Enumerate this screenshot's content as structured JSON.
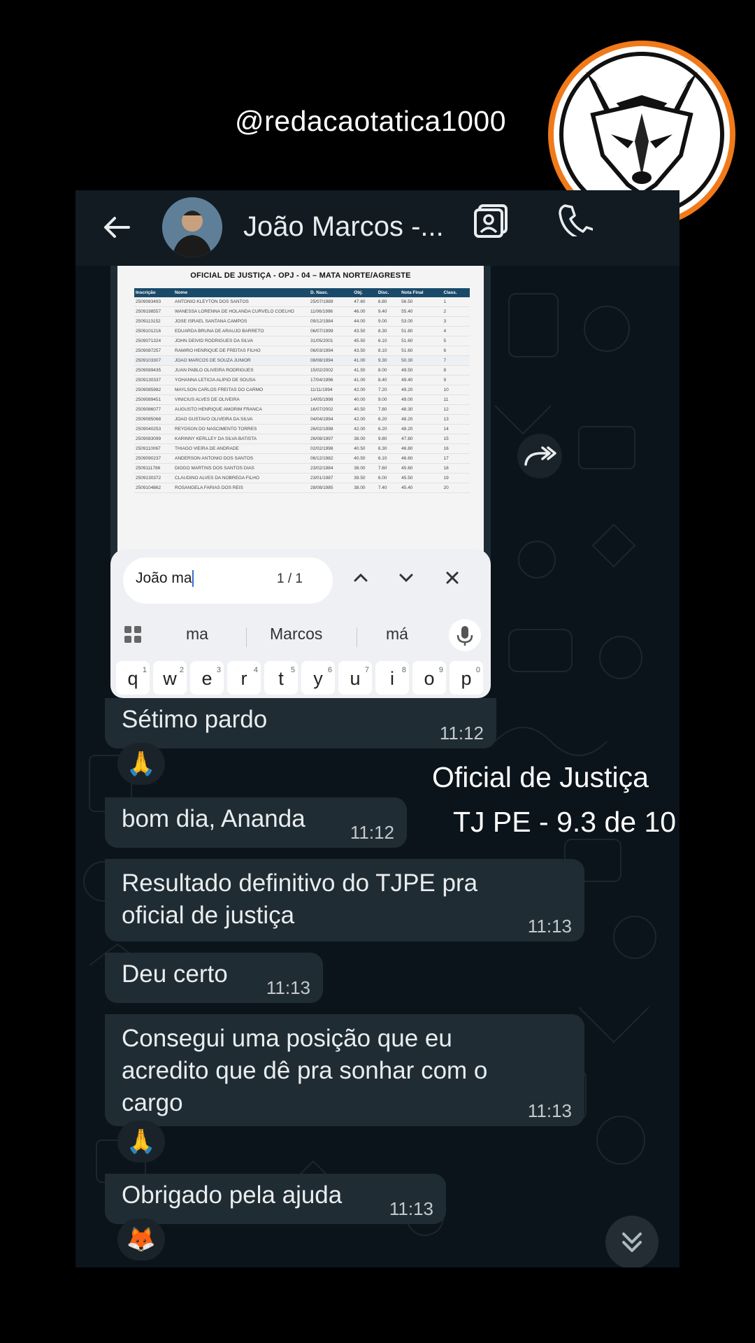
{
  "overlay": {
    "handle": "@redacaotatica1000",
    "caption_line1": "Oficial de Justiça",
    "caption_line2": "TJ PE - 9.3 de 10"
  },
  "chat_header": {
    "contact_name": "João Marcos -...",
    "icons": [
      "back-arrow-icon",
      "video-call-icon",
      "phone-call-icon"
    ]
  },
  "image_message": {
    "document_title": "OFICIAL DE JUSTIÇA - OPJ - 04 – MATA NORTE/AGRESTE",
    "columns": [
      "Inscrição",
      "Nome",
      "D. Nasc.",
      "Obj.",
      "Disc.",
      "Nota Final",
      "Class."
    ],
    "rows": [
      [
        "2509083493",
        "ANTONIO KLEYTON DOS SANTOS",
        "25/07/1989",
        "47.60",
        "8.80",
        "56.50",
        "1"
      ],
      [
        "2509198557",
        "WANESSA LORENNA DE HOLANDA CURVELO COELHO",
        "11/06/1996",
        "46.00",
        "9.40",
        "55.40",
        "2"
      ],
      [
        "2509113152",
        "JOSE ISRAEL SANTANA CAMPOS",
        "09/12/1984",
        "44.00",
        "9.00",
        "53.00",
        "3"
      ],
      [
        "2509101216",
        "EDUARDA BRUNA DE ARAUJO BARRETO",
        "06/07/1999",
        "43.50",
        "8.30",
        "51.80",
        "4"
      ],
      [
        "2509071324",
        "JOHN DEIVID RODRIGUES DA SILVA",
        "31/05/2001",
        "45.50",
        "6.10",
        "51.60",
        "5"
      ],
      [
        "2509087257",
        "RAMIRO HENRIQUE DE FREITAS FILHO",
        "06/03/1994",
        "43.50",
        "8.10",
        "51.60",
        "6"
      ],
      [
        "2509103307",
        "JOAO MARCOS DE SOUZA JUNIOR",
        "08/08/1994",
        "41.00",
        "9.30",
        "50.30",
        "7"
      ],
      [
        "2509089435",
        "JUAN PABLO OLIVEIRA RODRIGUES",
        "15/02/2002",
        "41.50",
        "8.00",
        "49.50",
        "8"
      ],
      [
        "2509130337",
        "YOHANNA LETICIA ALIPIO DE SOUSA",
        "17/04/1996",
        "41.00",
        "8.40",
        "49.40",
        "9"
      ],
      [
        "2509085982",
        "MAYLSON CARLOS FREITAS DO CARMO",
        "11/11/1994",
        "42.00",
        "7.20",
        "49.20",
        "10"
      ],
      [
        "2509089451",
        "VINICIUS ALVES DE OLIVEIRA",
        "14/05/1998",
        "40.00",
        "9.00",
        "49.00",
        "11"
      ],
      [
        "2509086077",
        "AUGUSTO HENRIQUE AMORIM FRANCA",
        "16/07/2002",
        "40.50",
        "7.80",
        "48.30",
        "12"
      ],
      [
        "2509085068",
        "JOAO GUSTAVO OLIVEIRA DA SILVA",
        "04/04/1994",
        "42.00",
        "6.20",
        "48.20",
        "13"
      ],
      [
        "2509040253",
        "REYDSON DO NASCIMENTO TORRES",
        "26/02/1998",
        "42.00",
        "6.20",
        "48.20",
        "14"
      ],
      [
        "2509083099",
        "KARINNY KERLLEY DA SILVA BATISTA",
        "26/08/1997",
        "38.00",
        "9.80",
        "47.80",
        "15"
      ],
      [
        "2509110067",
        "THIAGO VIEIRA DE ANDRADE",
        "02/02/1998",
        "40.50",
        "6.30",
        "46.80",
        "16"
      ],
      [
        "2509090237",
        "ANDERSON ANTONIO DOS SANTOS",
        "06/12/1982",
        "40.50",
        "6.10",
        "46.60",
        "17"
      ],
      [
        "2509111786",
        "DIOGO MARTINS DOS SANTOS DIAS",
        "23/02/1984",
        "38.00",
        "7.60",
        "45.60",
        "18"
      ],
      [
        "2509130372",
        "CLAUDINO ALVES DA NOBREGA FILHO",
        "23/01/1987",
        "39.50",
        "6.00",
        "45.50",
        "19"
      ],
      [
        "2509104862",
        "ROSANGELA FARIAS DOS REIS",
        "28/08/1985",
        "38.00",
        "7.40",
        "45.40",
        "20"
      ]
    ],
    "search_query": "João ma",
    "search_count": "1 / 1",
    "suggestions": [
      "ma",
      "Marcos",
      "má"
    ],
    "keys": [
      "q",
      "w",
      "e",
      "r",
      "t",
      "y",
      "u",
      "i",
      "o",
      "p"
    ],
    "key_numbers": [
      "1",
      "2",
      "3",
      "4",
      "5",
      "6",
      "7",
      "8",
      "9",
      "0"
    ]
  },
  "messages": [
    {
      "text": "Sétimo pardo",
      "time": "11:12",
      "reaction": "🙏"
    },
    {
      "text": "bom dia, Ananda",
      "time": "11:12"
    },
    {
      "text": "Resultado definitivo do TJPE pra oficial de justiça",
      "time": "11:13"
    },
    {
      "text": "Deu certo",
      "time": "11:13"
    },
    {
      "text": "Consegui uma posição que eu acredito que dê pra sonhar com o cargo",
      "time": "11:13",
      "reaction": "🙏"
    },
    {
      "text": "Obrigado pela ajuda",
      "time": "11:13",
      "reaction": "🦊"
    }
  ],
  "colors": {
    "background": "#000000",
    "chat_background": "#0b141a",
    "incoming_bubble": "#202c33",
    "header": "#121b22",
    "logo_accent": "#f07a1a"
  }
}
